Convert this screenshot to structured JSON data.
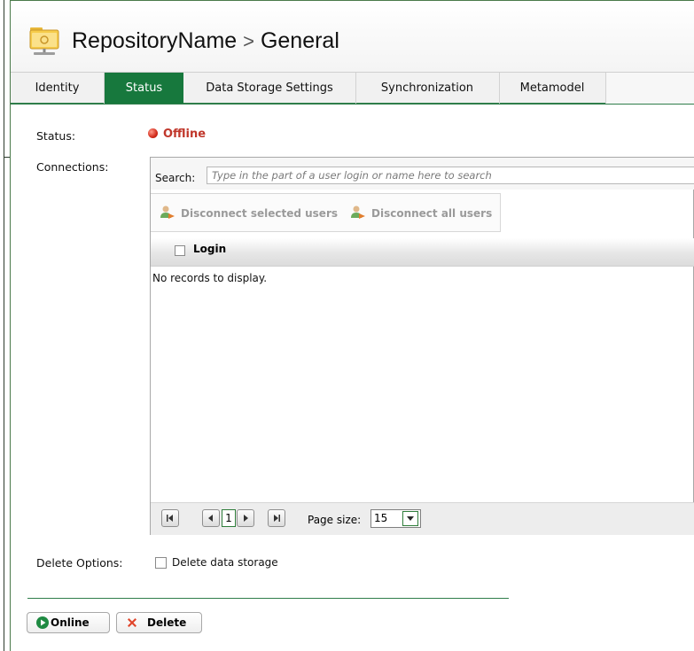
{
  "header": {
    "repository_name": "RepositoryName",
    "separator": ">",
    "section": "General"
  },
  "tabs": [
    {
      "label": "Identity",
      "active": false
    },
    {
      "label": "Status",
      "active": true
    },
    {
      "label": "Data Storage Settings",
      "active": false
    },
    {
      "label": "Synchronization",
      "active": false
    },
    {
      "label": "Metamodel",
      "active": false
    }
  ],
  "status": {
    "label": "Status:",
    "value": "Offline",
    "color": "#c0372b"
  },
  "connections": {
    "label": "Connections:",
    "search_label": "Search:",
    "search_placeholder": "Type in the part of a user login or name here to search",
    "search_value": "",
    "disconnect_selected_label": "Disconnect selected users",
    "disconnect_all_label": "Disconnect all users",
    "column_login": "Login",
    "empty_text": "No records to display.",
    "pager": {
      "current_page": "1",
      "page_size_label": "Page size:",
      "page_size_value": "15"
    }
  },
  "delete_options": {
    "label": "Delete Options:",
    "checkbox_label": "Delete data storage",
    "checked": false
  },
  "actions": {
    "online_label": "Online",
    "delete_label": "Delete"
  },
  "colors": {
    "accent": "#17783d",
    "status_offline": "#c0372b"
  }
}
